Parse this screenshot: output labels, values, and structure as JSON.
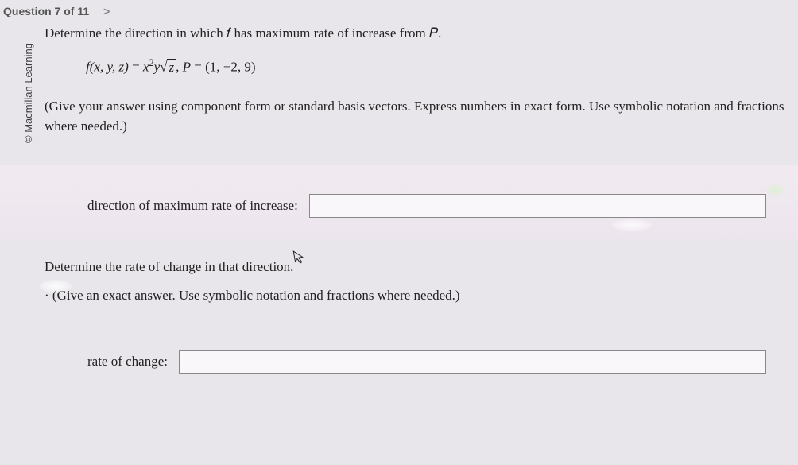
{
  "header": {
    "question_indicator": "Question 7 of 11",
    "next_icon": ">"
  },
  "copyright": "© Macmillan Learning",
  "prompt": "Determine the direction in which 𝑓 has maximum rate of increase from 𝑃.",
  "formula": {
    "lhs_f": "f",
    "lhs_args": "(x, y, z)",
    "eq": " = ",
    "x": "x",
    "xexp": "2",
    "y": "y",
    "sqrt": "√",
    "z": "z",
    "comma": ",   ",
    "P": "P",
    "Peq": " = ",
    "Pval": "(1, −2, 9)"
  },
  "instructions": "(Give your answer using component form or standard basis vectors. Express numbers in exact form. Use symbolic notation and fractions where needed.)",
  "answer1": {
    "label": "direction of maximum rate of increase:",
    "value": ""
  },
  "second": {
    "question": "Determine the rate of change in that direction.",
    "instructions": "(Give an exact answer. Use symbolic notation and fractions where needed.)"
  },
  "answer2": {
    "label": "rate of change:",
    "value": ""
  },
  "cursor_glyph": "↖"
}
